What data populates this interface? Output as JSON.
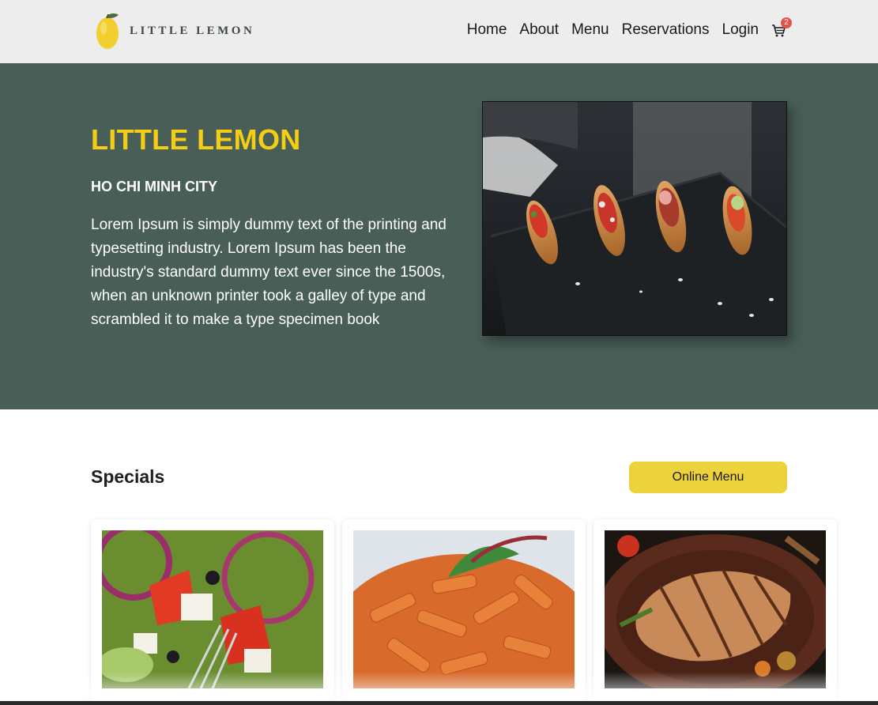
{
  "brand": {
    "logo_text": "LITTLE LEMON",
    "logo_icon": "lemon-icon",
    "colors": {
      "primary_green": "#495e57",
      "primary_yellow": "#f4ce14",
      "button_yellow": "#ecd33c",
      "badge_red": "#e2534a"
    }
  },
  "nav": {
    "items": [
      {
        "label": "Home"
      },
      {
        "label": "About"
      },
      {
        "label": "Menu"
      },
      {
        "label": "Reservations"
      },
      {
        "label": "Login"
      }
    ],
    "cart": {
      "icon": "cart-icon",
      "count": "2"
    }
  },
  "hero": {
    "title": "LITTLE LEMON",
    "subtitle": "HO CHI MINH CITY",
    "description": "Lorem Ipsum is simply dummy text of the printing and typesetting industry. Lorem Ipsum has been the industry's standard dummy text ever since the 1500s, when an unknown printer took a galley of type and scrambled it to make a type specimen book",
    "image": "plated-appetizers-photo"
  },
  "specials": {
    "title": "Specials",
    "button_label": "Online Menu",
    "cards": [
      {
        "image": "greek-salad-photo"
      },
      {
        "image": "penne-pasta-photo"
      },
      {
        "image": "grilled-chicken-photo"
      }
    ]
  }
}
